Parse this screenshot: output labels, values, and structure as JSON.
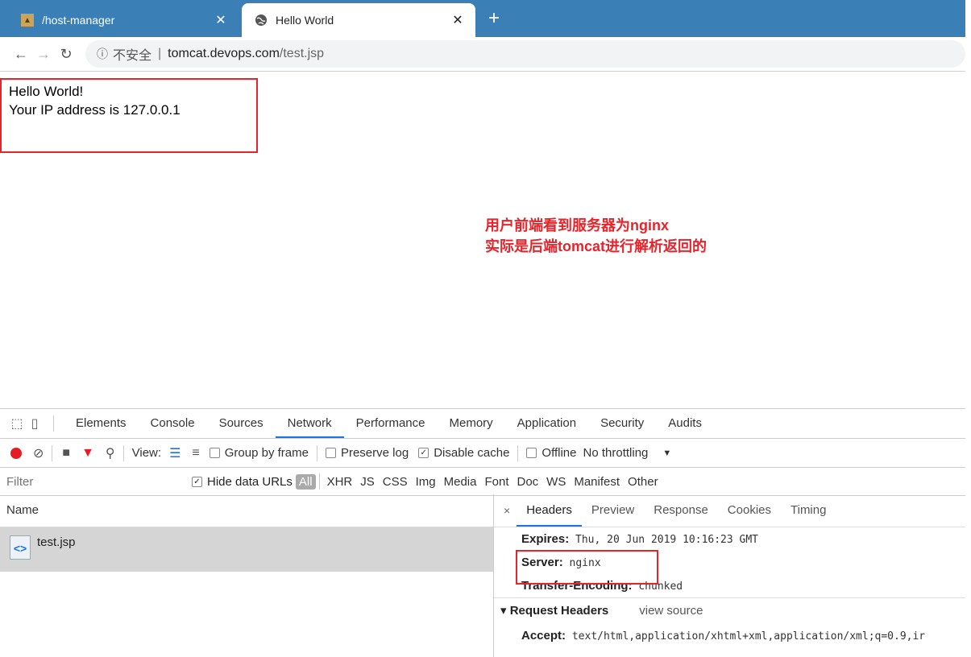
{
  "tabs": [
    {
      "title": "/host-manager",
      "close": "✕"
    },
    {
      "title": "Hello World",
      "close": "✕"
    }
  ],
  "new_tab": "+",
  "address": {
    "info": "ⓘ",
    "secure_label": "不安全",
    "separator": "|",
    "host": "tomcat.devops.com",
    "path": "/test.jsp"
  },
  "page": {
    "line1": "Hello World!",
    "line2": "Your IP address is 127.0.0.1"
  },
  "annotation": {
    "line1": "用户前端看到服务器为nginx",
    "line2": "实际是后端tomcat进行解析返回的"
  },
  "devtools": {
    "tabs": [
      "Elements",
      "Console",
      "Sources",
      "Network",
      "Performance",
      "Memory",
      "Application",
      "Security",
      "Audits"
    ],
    "active_tab": "Network",
    "toolbar": {
      "view_label": "View:",
      "group_by_frame": "Group by frame",
      "preserve_log": "Preserve log",
      "disable_cache": "Disable cache",
      "offline": "Offline",
      "throttling": "No throttling",
      "dropdown": "▼"
    },
    "filter": {
      "placeholder": "Filter",
      "hide_data_urls": "Hide data URLs",
      "types": [
        "All",
        "XHR",
        "JS",
        "CSS",
        "Img",
        "Media",
        "Font",
        "Doc",
        "WS",
        "Manifest",
        "Other"
      ]
    },
    "name_header": "Name",
    "request": {
      "name": "test.jsp",
      "icon_glyph": "<>"
    },
    "detail_close": "×",
    "detail_tabs": [
      "Headers",
      "Preview",
      "Response",
      "Cookies",
      "Timing"
    ],
    "headers": [
      {
        "key": "Expires:",
        "value": "Thu, 20 Jun 2019 10:16:23 GMT"
      },
      {
        "key": "Server:",
        "value": "nginx"
      },
      {
        "key": "Transfer-Encoding:",
        "value": "chunked"
      }
    ],
    "request_headers": {
      "title": "▾ Request Headers",
      "view_source": "view source",
      "accept_key": "Accept:",
      "accept_value": "text/html,application/xhtml+xml,application/xml;q=0.9,ir"
    }
  },
  "colors": {
    "accent": "#1a73e8",
    "annotation_red": "#e8232a",
    "tabstrip": "#3a7fb6"
  }
}
